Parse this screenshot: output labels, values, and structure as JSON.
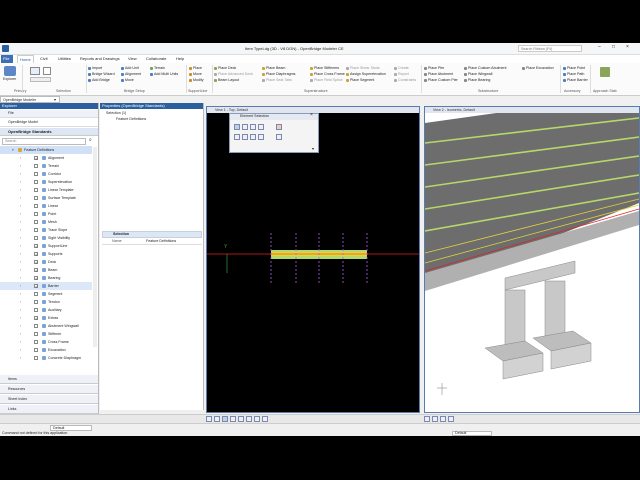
{
  "title": "Item TypeLdg (3D - V8 DGN) - OpenBridge Modeler CE",
  "search_placeholder": "Search Ribbon (F4)",
  "menu": [
    "File",
    "Home",
    "Civil",
    "Utilities",
    "Reports and Drawings",
    "View",
    "Collaborate",
    "Help"
  ],
  "workflow": "OpenBridge Modeler",
  "ribbon": {
    "primary": {
      "explorer": "Explorer",
      "label": "Primary"
    },
    "selection": {
      "label": "Selection"
    },
    "bridge_setup": {
      "items": [
        "Import",
        "Bridge Wizard",
        "Add Bridge",
        "Add Unit",
        "Alignment",
        "Move",
        "Terrain",
        "Add Multi Units"
      ],
      "label": "Bridge Setup"
    },
    "support_line": {
      "items": [
        "Place",
        "Move",
        "Modify"
      ],
      "label": "SupportLine"
    },
    "superstructure": {
      "items": [
        "Place Deck",
        "Place Advanced Deck",
        "Beam Layout",
        "Place Beam",
        "Place Diaphragms",
        "Place Seat Tabs",
        "Place Stiffeners",
        "Place Cross Frame",
        "Place Field Splice",
        "Place Shear Studs",
        "Assign Superelevation",
        "Place Segment",
        "Create",
        "Report",
        "Constraints"
      ],
      "label": "Superstructure"
    },
    "substructure": {
      "items": [
        "Place Pier",
        "Place Abutment",
        "Place Custom Pier",
        "Place Custom Abutment",
        "Place Wingwall",
        "Place Bearing",
        "Place Excavation"
      ],
      "label": "Substructure"
    },
    "accessory": {
      "items": [
        "Place Point",
        "Place Path",
        "Place Barrier"
      ],
      "label": "Accessory"
    },
    "approach_slab": {
      "label": "Approach Slab"
    }
  },
  "explorer": {
    "title": "Explorer",
    "sections": [
      "File",
      "OpenBridge Model",
      "OpenBridge Standards"
    ],
    "search_placeholder": "Search",
    "tree": [
      {
        "label": "Feature Definitions",
        "level": 0,
        "selected": true
      },
      {
        "label": "Alignment",
        "level": 1,
        "checked": true
      },
      {
        "label": "Terrain",
        "level": 1
      },
      {
        "label": "Corridor",
        "level": 1
      },
      {
        "label": "Superelevation",
        "level": 1
      },
      {
        "label": "Linear Template",
        "level": 1
      },
      {
        "label": "Surface Template",
        "level": 1
      },
      {
        "label": "Linear",
        "level": 1
      },
      {
        "label": "Point",
        "level": 1
      },
      {
        "label": "Mesh",
        "level": 1
      },
      {
        "label": "Trace Slope",
        "level": 1
      },
      {
        "label": "Sight Visibility",
        "level": 1
      },
      {
        "label": "SupportLine",
        "level": 1,
        "checked": true
      },
      {
        "label": "Supports",
        "level": 1,
        "checked": true
      },
      {
        "label": "Deck",
        "level": 1,
        "checked": true
      },
      {
        "label": "Beam",
        "level": 1,
        "checked": true
      },
      {
        "label": "Bearing",
        "level": 1,
        "checked": true
      },
      {
        "label": "Barrier",
        "level": 1,
        "checked": true,
        "highlight": true
      },
      {
        "label": "Segment",
        "level": 1
      },
      {
        "label": "Tendon",
        "level": 1
      },
      {
        "label": "Auxiliary",
        "level": 1
      },
      {
        "label": "Extras",
        "level": 1,
        "checked": true
      },
      {
        "label": "Abutment Wingwall",
        "level": 1
      },
      {
        "label": "Stiffener",
        "level": 1
      },
      {
        "label": "Cross Frame",
        "level": 1
      },
      {
        "label": "Excavation",
        "level": 1
      },
      {
        "label": "Concrete Diaphragm",
        "level": 1
      }
    ],
    "bottom_sections": [
      "Items",
      "Resources",
      "Sheet Index",
      "Links"
    ]
  },
  "properties": {
    "title": "Properties (OpenBridge Standards)",
    "selection_label": "Selection (1)",
    "selection_item": "Feature Definitions",
    "group": "Selection",
    "name_label": "Name",
    "name_value": "Feature Definitions"
  },
  "view1": {
    "title": "View 1 - Top, Default"
  },
  "view2": {
    "title": "View 2 - Isometric, Default"
  },
  "element_selection": {
    "title": "Element Selection"
  },
  "status": {
    "message": "Command not defined for this application",
    "level_default": "Default",
    "level_default2": "Default"
  },
  "colors": {
    "accent": "#2c5f9e",
    "view_border": "#5a7bb0",
    "deck_green": "#b6d86a",
    "beam_yellow": "#e6d23a",
    "axis_red": "#e02020"
  }
}
